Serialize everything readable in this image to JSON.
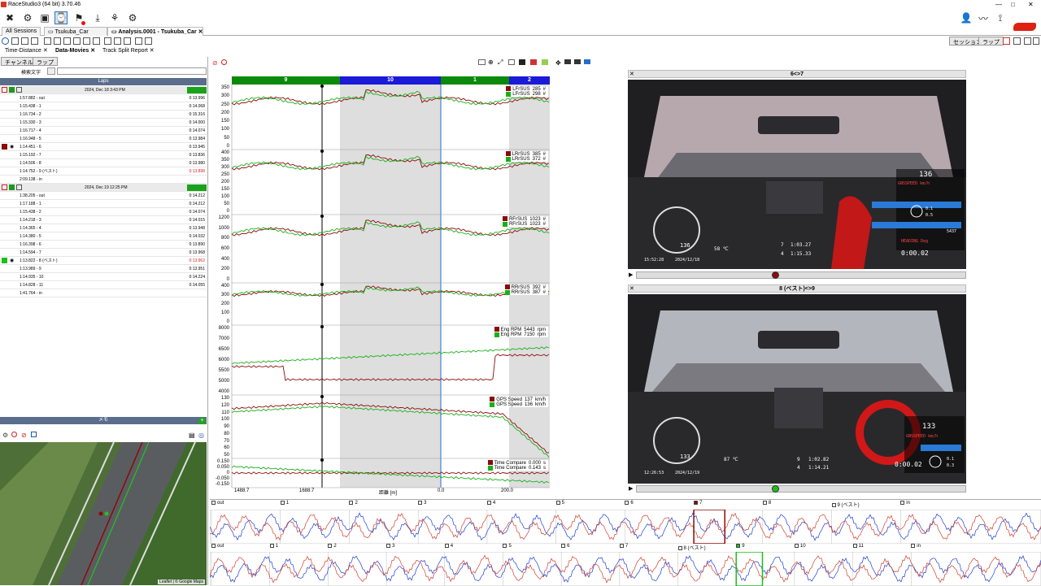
{
  "window": {
    "title": "RaceStudio3 (64 bit) 3.70.46"
  },
  "tabs": [
    {
      "label": "All Sessions"
    },
    {
      "label": "Tsukuba_Car"
    },
    {
      "label": "Analysis.0001 - Tsukuba_Car"
    }
  ],
  "right_buttons": {
    "session": "セッション",
    "lap": "ラップ"
  },
  "view_tabs": [
    {
      "label": "Time-Distance"
    },
    {
      "label": "Data-Movies"
    },
    {
      "label": "Track Split Report"
    }
  ],
  "left": {
    "subtabs": [
      "チャンネル",
      "ラップ"
    ],
    "search_label": "検索文字",
    "search_value": "",
    "laps_header": "Laps",
    "sessions": [
      {
        "date": "2024, Dec 18 3:43 PM",
        "laps": [
          {
            "label": "1:57.882 - out",
            "value": "0:13.996"
          },
          {
            "label": "1:15.438 - 1",
            "value": "0:14.068"
          },
          {
            "label": "1:16.734 - 2",
            "value": "0:15.316"
          },
          {
            "label": "1:15.330 - 3",
            "value": "0:14.000"
          },
          {
            "label": "1:16.717 - 4",
            "value": "0:14.074"
          },
          {
            "label": "1:16.948 - 5",
            "value": "0:13.984"
          },
          {
            "label": "1:14.451 - 6",
            "value": "0:13.945"
          },
          {
            "label": "1:15.192 - 7",
            "value": "0:13.836"
          },
          {
            "label": "1:14.506 - 8",
            "value": "0:13.980"
          },
          {
            "label": "1:14.752 - 9 (ベスト)",
            "value": "0:13.898"
          },
          {
            "label": "2:09.138 - in",
            "value": ""
          }
        ]
      },
      {
        "date": "2024, Dec 19 12:25 PM",
        "laps": [
          {
            "label": "1:38.205 - out",
            "value": "0:14.212"
          },
          {
            "label": "1:17.188 - 1",
            "value": "0:14.212"
          },
          {
            "label": "1:15.438 - 2",
            "value": "0:14.074"
          },
          {
            "label": "1:14.218 - 3",
            "value": "0:14.015"
          },
          {
            "label": "1:14.365 - 4",
            "value": "0:13.948"
          },
          {
            "label": "1:14.380 - 5",
            "value": "0:14.032"
          },
          {
            "label": "1:16.398 - 6",
            "value": "0:13.890"
          },
          {
            "label": "1:14.594 - 7",
            "value": "0:13.968"
          },
          {
            "label": "1:13.822 - 8 (ベスト)",
            "value": "0:13.962"
          },
          {
            "label": "1:13.989 - 9",
            "value": "0:13.951"
          },
          {
            "label": "1:14.935 - 10",
            "value": "0:14.224"
          },
          {
            "label": "1:14.828 - 11",
            "value": "0:14.055"
          },
          {
            "label": "1:41.764 - in",
            "value": ""
          }
        ]
      }
    ],
    "memo_header": "メモ",
    "map_attribution": "Leaflet | © Google Maps"
  },
  "chart": {
    "segments": [
      {
        "label": "9",
        "color": "#0a8a0a"
      },
      {
        "label": "10",
        "color": "#1a1ad8"
      },
      {
        "label": "1",
        "color": "#0a8a0a"
      },
      {
        "label": "2",
        "color": "#1a1ad8"
      }
    ],
    "panels": [
      {
        "ticks": [
          "350",
          "300",
          "250",
          "200",
          "150",
          "100",
          "50",
          "0"
        ],
        "legend": [
          {
            "name": "LFrSUS",
            "value": "285",
            "unit": "#",
            "color": "#8b0a0a"
          },
          {
            "name": "LFrSUS",
            "value": "298",
            "unit": "#",
            "color": "#18b018"
          }
        ]
      },
      {
        "ticks": [
          "400",
          "350",
          "300",
          "250",
          "200",
          "150",
          "100",
          "50",
          "0"
        ],
        "legend": [
          {
            "name": "LRrSUS",
            "value": "385",
            "unit": "#",
            "color": "#8b0a0a"
          },
          {
            "name": "LRrSUS",
            "value": "372",
            "unit": "#",
            "color": "#18b018"
          }
        ]
      },
      {
        "ticks": [
          "1200",
          "1000",
          "800",
          "600",
          "400",
          "200",
          "0"
        ],
        "legend": [
          {
            "name": "RFrSUS",
            "value": "1023",
            "unit": "#",
            "color": "#8b0a0a"
          },
          {
            "name": "RFrSUS",
            "value": "1023",
            "unit": "#",
            "color": "#18b018"
          }
        ]
      },
      {
        "ticks": [
          "400",
          "300",
          "200",
          "100",
          "0"
        ],
        "legend": [
          {
            "name": "RRrSUS",
            "value": "392",
            "unit": "#",
            "color": "#8b0a0a"
          },
          {
            "name": "RRrSUS",
            "value": "387",
            "unit": "#",
            "color": "#18b018"
          }
        ]
      },
      {
        "ticks": [
          "8000",
          "7000",
          "6500",
          "6000",
          "5500",
          "5000",
          "4000"
        ],
        "legend": [
          {
            "name": "Eng RPM",
            "value": "5443",
            "unit": "rpm",
            "color": "#8b0a0a"
          },
          {
            "name": "Eng RPM",
            "value": "7150",
            "unit": "rpm",
            "color": "#18b018"
          }
        ]
      },
      {
        "ticks": [
          "130",
          "120",
          "110",
          "100",
          "90",
          "80",
          "70",
          "60",
          "50"
        ],
        "legend": [
          {
            "name": "GPS Speed",
            "value": "137",
            "unit": "km/h",
            "color": "#8b0a0a"
          },
          {
            "name": "GPS Speed",
            "value": "136",
            "unit": "km/h",
            "color": "#18b018"
          }
        ]
      },
      {
        "ticks": [
          "0.150",
          "0.050",
          "0",
          "-0.050",
          "-0.150"
        ],
        "legend": [
          {
            "name": "Time Compare",
            "value": "0.000",
            "unit": "s",
            "color": "#8b0a0a"
          },
          {
            "name": "Time Compare",
            "value": "0.143",
            "unit": "s",
            "color": "#18b018"
          }
        ]
      }
    ],
    "x_labels": [
      "1488.7",
      "1688.7",
      "0.0",
      "200.0"
    ],
    "x_title": "距離 [m]"
  },
  "videos": [
    {
      "title": "6<>7",
      "hud": {
        "speed": "136",
        "speed_label": "GNSSPEED km/h",
        "time": "15:52:28",
        "date": "2024/12/18",
        "gauge_speed": "136",
        "temp": "58 ℃",
        "lap_last": "7",
        "time_last": "1:03.27",
        "lap_best": "4",
        "time_best": "1:15.33",
        "delta": "0:00.02",
        "heading": "HEADING Deg",
        "odo": "5437",
        "g1": "0.1",
        "g2": "0.5"
      },
      "progress": 0.42,
      "marker_color": "#8b0a0a"
    },
    {
      "title": "8 (ベスト)<>9",
      "hud": {
        "speed": "133",
        "speed_label": "GNSSPEED km/h",
        "time": "12:26:53",
        "date": "2024/12/19",
        "gauge_speed": "133",
        "temp": "87 ℃",
        "lap_last": "9",
        "time_last": "1:02.82",
        "lap_best": "4",
        "time_best": "1:14.21",
        "delta": "0:00.02",
        "heading": "",
        "odo": "",
        "g1": "0.1",
        "g2": "0.3"
      },
      "progress": 0.42,
      "marker_color": "#18c018"
    }
  ],
  "bottom": {
    "row1_labels": [
      "out",
      "1",
      "2",
      "3",
      "4",
      "5",
      "6",
      "7",
      "8",
      "9 (ベスト)",
      "in"
    ],
    "row2_labels": [
      "out",
      "1",
      "2",
      "3",
      "4",
      "5",
      "6",
      "7",
      "8 (ベスト)",
      "9",
      "10",
      "11",
      "in"
    ]
  }
}
